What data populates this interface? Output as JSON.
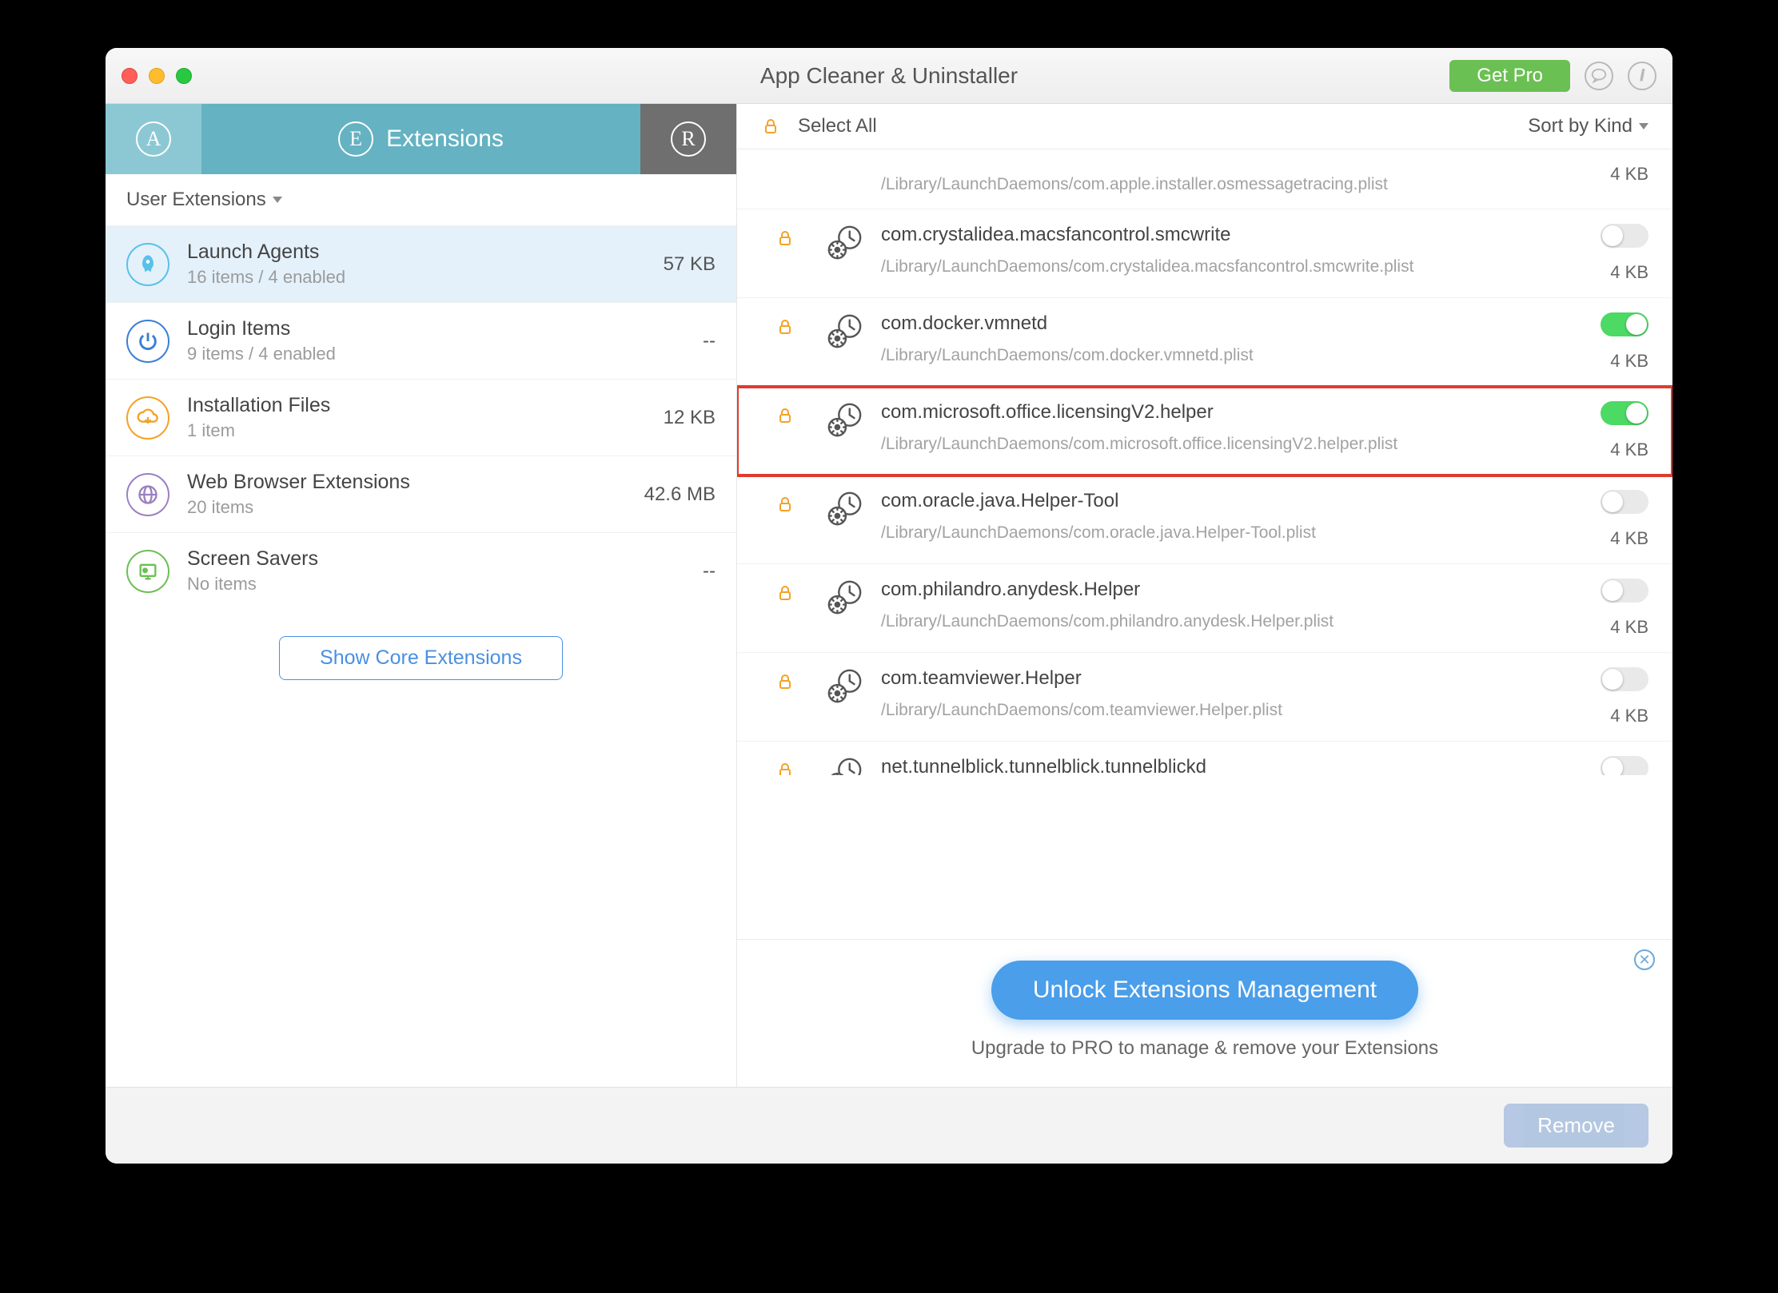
{
  "window": {
    "title": "App Cleaner & Uninstaller",
    "get_pro": "Get Pro"
  },
  "tabs": {
    "extensions_label": "Extensions"
  },
  "filter": {
    "label": "User Extensions"
  },
  "categories": [
    {
      "title": "Launch Agents",
      "sub": "16 items / 4 enabled",
      "size": "57 KB",
      "icon": "rocket",
      "color": "blue",
      "selected": true
    },
    {
      "title": "Login Items",
      "sub": "9 items / 4 enabled",
      "size": "--",
      "icon": "power",
      "color": "blue2",
      "selected": false
    },
    {
      "title": "Installation Files",
      "sub": "1 item",
      "size": "12 KB",
      "icon": "cloud-down",
      "color": "orange",
      "selected": false
    },
    {
      "title": "Web Browser Extensions",
      "sub": "20 items",
      "size": "42.6 MB",
      "icon": "globe",
      "color": "purple",
      "selected": false
    },
    {
      "title": "Screen Savers",
      "sub": "No items",
      "size": "--",
      "icon": "screen",
      "color": "green",
      "selected": false
    }
  ],
  "show_core": "Show Core Extensions",
  "list_header": {
    "select_all": "Select All",
    "sort": "Sort by Kind"
  },
  "items": [
    {
      "name": "",
      "path": "/Library/LaunchDaemons/com.apple.installer.osmessagetracing.plist",
      "size": "4 KB",
      "toggle": null,
      "partial": true,
      "highlight": false
    },
    {
      "name": "com.crystalidea.macsfancontrol.smcwrite",
      "path": "/Library/LaunchDaemons/com.crystalidea.macsfancontrol.smcwrite.plist",
      "size": "4 KB",
      "toggle": "off",
      "highlight": false
    },
    {
      "name": "com.docker.vmnetd",
      "path": "/Library/LaunchDaemons/com.docker.vmnetd.plist",
      "size": "4 KB",
      "toggle": "on",
      "highlight": false
    },
    {
      "name": "com.microsoft.office.licensingV2.helper",
      "path": "/Library/LaunchDaemons/com.microsoft.office.licensingV2.helper.plist",
      "size": "4 KB",
      "toggle": "on",
      "highlight": true
    },
    {
      "name": "com.oracle.java.Helper-Tool",
      "path": "/Library/LaunchDaemons/com.oracle.java.Helper-Tool.plist",
      "size": "4 KB",
      "toggle": "off",
      "highlight": false
    },
    {
      "name": "com.philandro.anydesk.Helper",
      "path": "/Library/LaunchDaemons/com.philandro.anydesk.Helper.plist",
      "size": "4 KB",
      "toggle": "off",
      "highlight": false
    },
    {
      "name": "com.teamviewer.Helper",
      "path": "/Library/LaunchDaemons/com.teamviewer.Helper.plist",
      "size": "4 KB",
      "toggle": "off",
      "highlight": false
    },
    {
      "name": "net.tunnelblick.tunnelblick.tunnelblickd",
      "path": "",
      "size": "",
      "toggle": "off",
      "partial_bottom": true,
      "highlight": false
    }
  ],
  "promo": {
    "button": "Unlock Extensions Management",
    "text": "Upgrade to PRO to manage & remove your Extensions"
  },
  "footer": {
    "remove": "Remove"
  }
}
